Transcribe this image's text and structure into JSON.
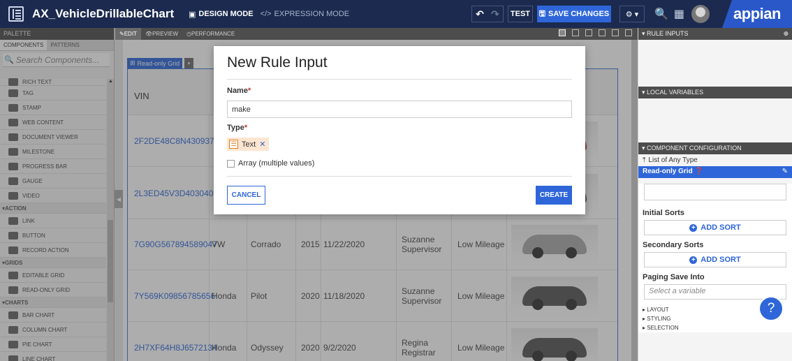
{
  "topbar": {
    "title": "AX_VehicleDrillableChart",
    "design_mode": "DESIGN MODE",
    "expression_mode": "EXPRESSION MODE",
    "test": "TEST",
    "save_changes": "SAVE CHANGES",
    "logo": "appian"
  },
  "palette": {
    "header": "PALETTE",
    "tabs": [
      "COMPONENTS",
      "PATTERNS"
    ],
    "search_placeholder": "Search Components...",
    "items": [
      {
        "kind": "item",
        "label": "RICH TEXT"
      },
      {
        "kind": "item",
        "label": "TAG"
      },
      {
        "kind": "item",
        "label": "STAMP"
      },
      {
        "kind": "item",
        "label": "WEB CONTENT"
      },
      {
        "kind": "item",
        "label": "DOCUMENT VIEWER"
      },
      {
        "kind": "item",
        "label": "MILESTONE"
      },
      {
        "kind": "item",
        "label": "PROGRESS BAR"
      },
      {
        "kind": "item",
        "label": "GAUGE"
      },
      {
        "kind": "item",
        "label": "VIDEO"
      },
      {
        "kind": "cat",
        "label": "ACTION"
      },
      {
        "kind": "item",
        "label": "LINK"
      },
      {
        "kind": "item",
        "label": "BUTTON"
      },
      {
        "kind": "item",
        "label": "RECORD ACTION"
      },
      {
        "kind": "cat",
        "label": "GRIDS"
      },
      {
        "kind": "item",
        "label": "EDITABLE GRID"
      },
      {
        "kind": "item",
        "label": "READ-ONLY GRID"
      },
      {
        "kind": "cat",
        "label": "CHARTS"
      },
      {
        "kind": "item",
        "label": "BAR CHART"
      },
      {
        "kind": "item",
        "label": "COLUMN CHART"
      },
      {
        "kind": "item",
        "label": "PIE CHART"
      },
      {
        "kind": "item",
        "label": "LINE CHART"
      }
    ]
  },
  "canvas": {
    "tabs": [
      "EDIT",
      "PREVIEW",
      "PERFORMANCE"
    ],
    "grid_label": "Read-only Grid",
    "column_vin": "VIN",
    "rows": [
      {
        "vin": "2F2DE48C8N4309374",
        "make": "",
        "model": "",
        "year": "",
        "date": "",
        "person": "",
        "mileage": "",
        "car": "red"
      },
      {
        "vin": "2L3ED45V3D4030403",
        "make": "",
        "model": "",
        "year": "",
        "date": "",
        "person": "",
        "mileage": "",
        "car": "dark"
      },
      {
        "vin": "7G90G567894589047",
        "make": "VW",
        "model": "Corrado",
        "year": "2015",
        "date": "11/22/2020",
        "person": "Suzanne Supervisor",
        "mileage": "Low Mileage",
        "car": "light"
      },
      {
        "vin": "7Y569K09856785656",
        "make": "Honda",
        "model": "Pilot",
        "year": "2020",
        "date": "11/18/2020",
        "person": "Suzanne Supervisor",
        "mileage": "Low Mileage",
        "car": "dark"
      },
      {
        "vin": "2H7XF64H8J6572134",
        "make": "Honda",
        "model": "Odyssey",
        "year": "2020",
        "date": "9/2/2020",
        "person": "Regina Registrar",
        "mileage": "Low Mileage",
        "car": "dark"
      }
    ]
  },
  "right_panel": {
    "rule_inputs": "RULE INPUTS",
    "local_variables": "LOCAL VARIABLES",
    "component_configuration": "COMPONENT CONFIGURATION",
    "list_of_any_type": "List of Any Type",
    "grid_title": "Read-only Grid",
    "initial_sorts": "Initial Sorts",
    "add_sort": "ADD SORT",
    "secondary_sorts": "Secondary Sorts",
    "paging_save_into": "Paging Save Into",
    "select_variable": "Select a variable",
    "sections": [
      "LAYOUT",
      "STYLING",
      "SELECTION"
    ]
  },
  "dialog": {
    "title": "New Rule Input",
    "name_label": "Name",
    "name_value": "make",
    "type_label": "Type",
    "type_value": "Text",
    "array_label": "Array (multiple values)",
    "cancel": "CANCEL",
    "create": "CREATE"
  },
  "colors": {
    "accent": "#2e66d9",
    "topbar": "#1b2a4e",
    "type_chip": "#fde6d1"
  }
}
